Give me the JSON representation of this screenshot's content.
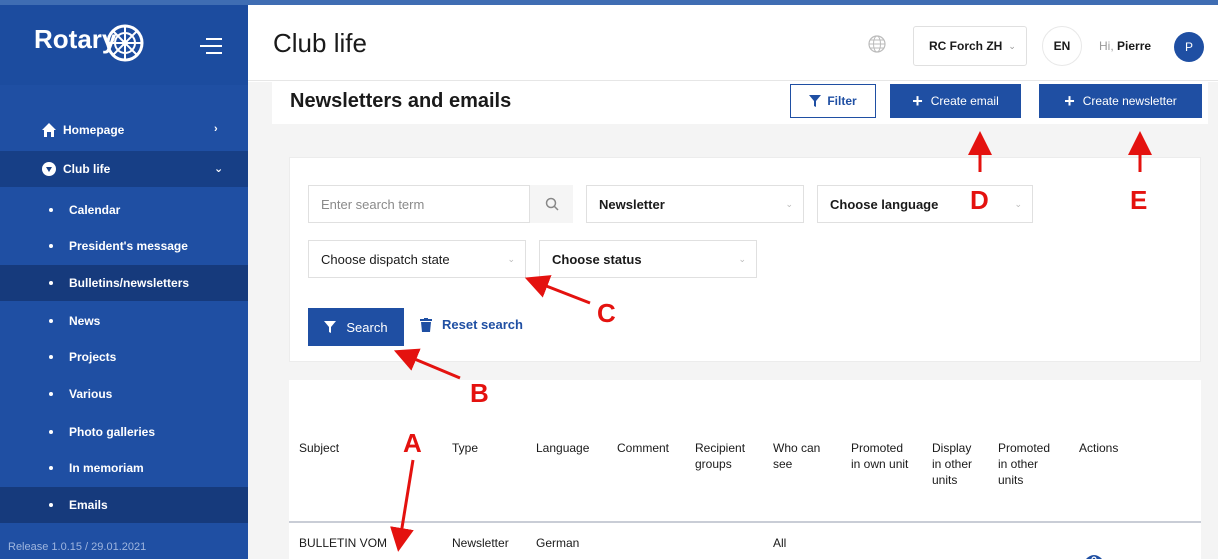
{
  "sidebar": {
    "logo": "Rotary",
    "items": [
      {
        "label": "Homepage",
        "icon": "home-icon"
      },
      {
        "label": "Club life",
        "icon": "club-icon"
      }
    ],
    "subitems": [
      "Calendar",
      "President's message",
      "Bulletins/newsletters",
      "News",
      "Projects",
      "Various",
      "Photo galleries",
      "In memoriam",
      "Emails"
    ],
    "release": "Release 1.0.15 / 29.01.2021"
  },
  "header": {
    "title": "Club life",
    "club": "RC Forch ZH",
    "language": "EN",
    "greeting_prefix": "Hi,",
    "user": "Pierre",
    "avatar_initial": "P"
  },
  "main": {
    "section_title": "Newsletters and emails",
    "filter_label": "Filter",
    "create_email_label": "Create email",
    "create_newsletter_label": "Create newsletter"
  },
  "search": {
    "placeholder": "Enter search term",
    "type_value": "Newsletter",
    "language_placeholder": "Choose language",
    "dispatch_placeholder": "Choose dispatch state",
    "status_placeholder": "Choose status",
    "search_label": "Search",
    "reset_label": "Reset search"
  },
  "table": {
    "headers": [
      "Subject",
      "Type",
      "Language",
      "Comment",
      "Recipient groups",
      "Who can see",
      "Promoted in own unit",
      "Display in other units",
      "Promoted in other units",
      "Actions"
    ],
    "rows": [
      {
        "subject": "BULLETIN VOM",
        "type": "Newsletter",
        "language": "German",
        "who_can_see": "All"
      }
    ]
  },
  "annotations": [
    "A",
    "B",
    "C",
    "D",
    "E"
  ],
  "colors": {
    "brand": "#1f4fa3",
    "annotation": "#e4120f"
  }
}
